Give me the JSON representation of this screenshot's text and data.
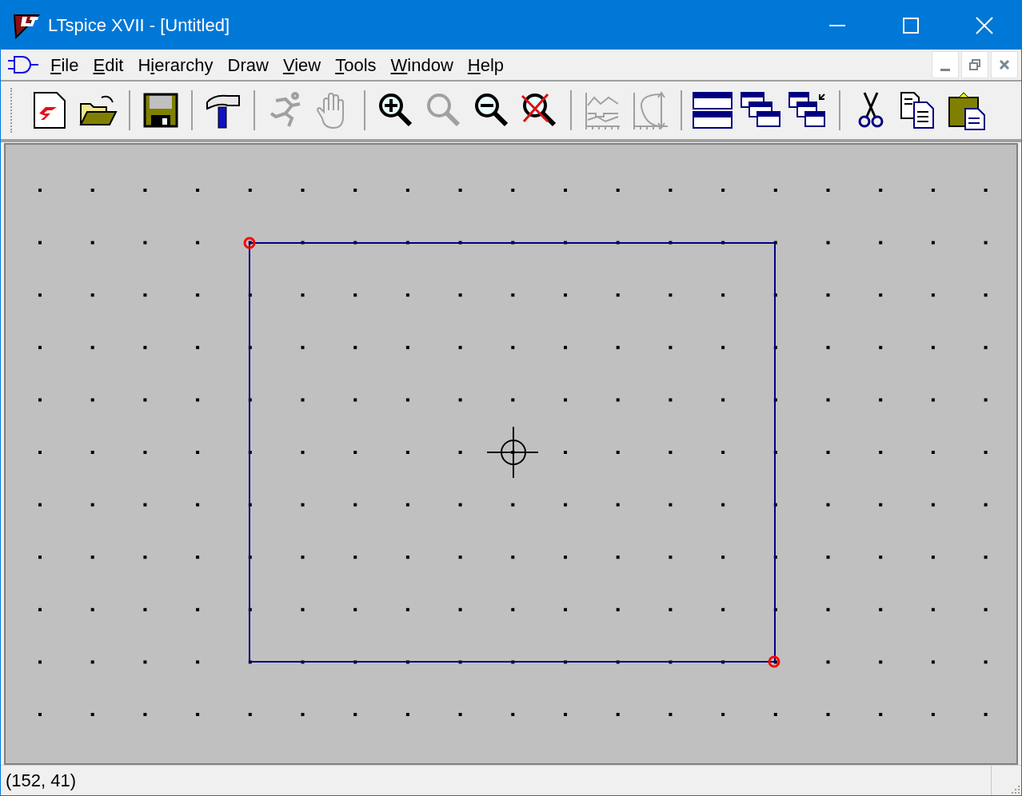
{
  "window": {
    "title": "LTspice XVII - [Untitled]"
  },
  "menu": [
    {
      "key": "F",
      "after": "ile"
    },
    {
      "key": "E",
      "after": "dit"
    },
    {
      "before": "H",
      "key": "i",
      "after": "erarchy"
    },
    {
      "after": "Draw"
    },
    {
      "key": "V",
      "after": "iew"
    },
    {
      "key": "T",
      "after": "ools"
    },
    {
      "key": "W",
      "after": "indow"
    },
    {
      "key": "H",
      "after": "elp"
    }
  ],
  "toolbar_groups": [
    [
      {
        "kind": "new",
        "disabled": false
      },
      {
        "kind": "open",
        "disabled": false
      }
    ],
    [
      {
        "kind": "save",
        "disabled": false
      }
    ],
    [
      {
        "kind": "hammer",
        "disabled": false
      }
    ],
    [
      {
        "kind": "run",
        "disabled": true
      },
      {
        "kind": "hand",
        "disabled": true
      }
    ],
    [
      {
        "kind": "zoomin",
        "disabled": false
      },
      {
        "kind": "zoom",
        "disabled": true
      },
      {
        "kind": "zoomout",
        "disabled": false
      },
      {
        "kind": "zoomfit",
        "disabled": false
      }
    ],
    [
      {
        "kind": "plot",
        "disabled": true
      },
      {
        "kind": "smith",
        "disabled": true
      }
    ],
    [
      {
        "kind": "tile",
        "disabled": false
      },
      {
        "kind": "cascade",
        "disabled": false
      },
      {
        "kind": "arrange",
        "disabled": false
      }
    ],
    [
      {
        "kind": "cut",
        "disabled": false
      },
      {
        "kind": "copy",
        "disabled": false
      },
      {
        "kind": "paste",
        "disabled": false
      }
    ]
  ],
  "status_bar": {
    "coordinates": "(152, 41)"
  }
}
